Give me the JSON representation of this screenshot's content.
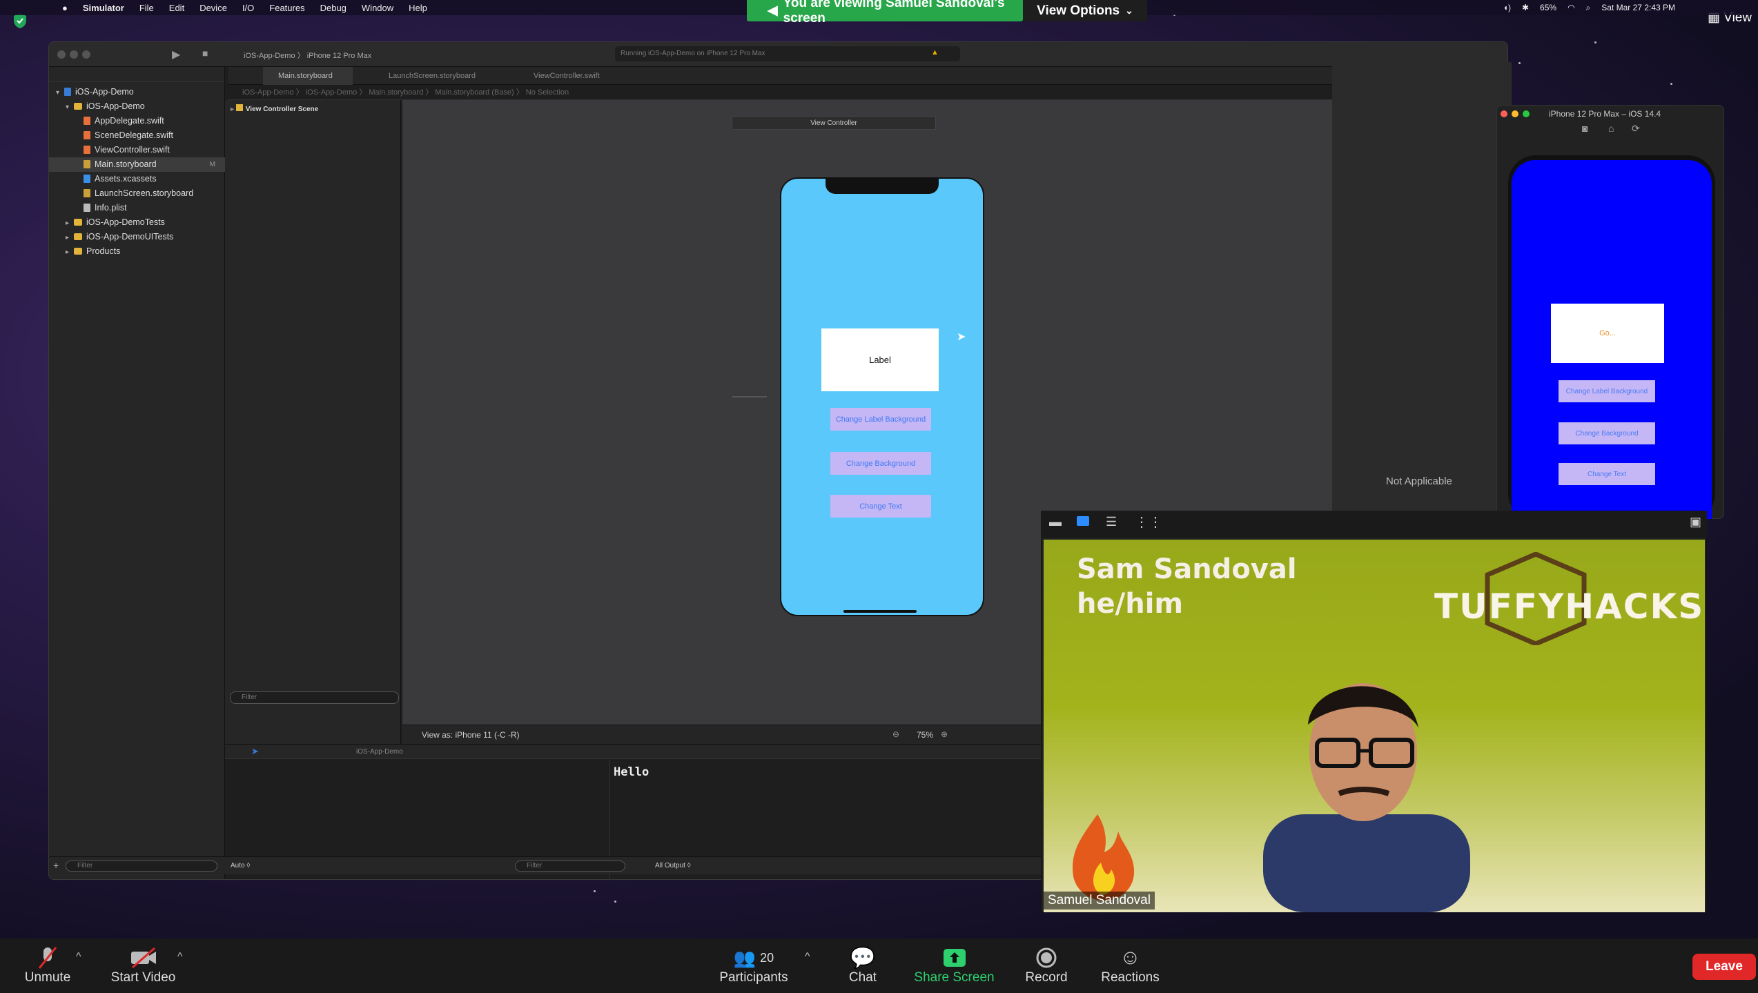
{
  "menubar": {
    "apple": "",
    "app": "Simulator",
    "items": [
      "File",
      "Edit",
      "Device",
      "I/O",
      "Features",
      "Debug",
      "Window",
      "Help"
    ],
    "battery": "65%",
    "datetime": "Sat Mar 27  2:43 PM"
  },
  "zoom": {
    "banner": "You are viewing Samuel Sandoval's screen",
    "view_options": "View Options",
    "view_label": "View",
    "participants_count": "20",
    "buttons": {
      "unmute": "Unmute",
      "start_video": "Start Video",
      "participants": "Participants",
      "chat": "Chat",
      "share_screen": "Share Screen",
      "record": "Record",
      "reactions": "Reactions",
      "leave": "Leave"
    },
    "colors": {
      "share_green": "#28a74a",
      "leave_red": "#e02828"
    }
  },
  "xcode": {
    "scheme": "iOS-App-Demo",
    "device": "iPhone 12 Pro Max",
    "status": "Running iOS-App-Demo on iPhone 12 Pro Max",
    "tabs": [
      "Main.storyboard",
      "LaunchScreen.storyboard",
      "ViewController.swift"
    ],
    "jumpbar": "iOS-App-Demo 〉 iOS-App-Demo 〉 Main.storyboard 〉 Main.storyboard (Base) 〉 No Selection",
    "navigator": {
      "project": "iOS-App-Demo",
      "group": "iOS-App-Demo",
      "files": [
        "AppDelegate.swift",
        "SceneDelegate.swift",
        "ViewController.swift",
        "Main.storyboard",
        "Assets.xcassets",
        "LaunchScreen.storyboard",
        "Info.plist"
      ],
      "selected_badge": "M",
      "groups": [
        "iOS-App-DemoTests",
        "iOS-App-DemoUITests",
        "Products"
      ],
      "filter_placeholder": "Filter"
    },
    "outline": {
      "scene": "View Controller Scene",
      "filter_placeholder": "Filter"
    },
    "canvas": {
      "scene_title": "View Controller",
      "label_text": "Label",
      "buttons": [
        "Change Label Background",
        "Change Background",
        "Change Text"
      ],
      "view_as": "View as: iPhone 11 (‑C ‑R)",
      "zoom_level": "75%"
    },
    "debug": {
      "target": "iOS-App-Demo",
      "console_output": "Hello",
      "auto": "Auto ◊",
      "all_output": "All Output ◊",
      "filter_placeholder": "Filter"
    }
  },
  "simulator": {
    "title": "iPhone 12 Pro Max – iOS 14.4",
    "label_text": "Go...",
    "buttons": [
      "Change Label Background",
      "Change Background",
      "Change Text"
    ],
    "bg_color": "#0000ff"
  },
  "inspector": {
    "not_applicable": "Not Applicable"
  },
  "video": {
    "name_line1": "Sam Sandoval",
    "name_line2": "he/him",
    "brand": "TUFFYHACKS",
    "name_tag": "Samuel Sandoval"
  }
}
